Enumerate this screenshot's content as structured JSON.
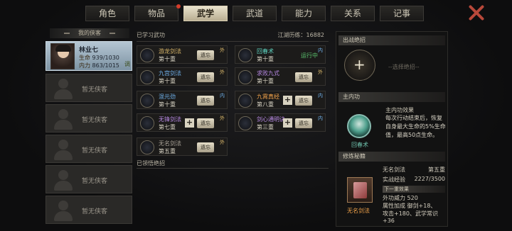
{
  "tabs": [
    {
      "label": "角色",
      "active": false
    },
    {
      "label": "物品",
      "active": false,
      "dot": true
    },
    {
      "label": "武学",
      "active": true
    },
    {
      "label": "武道",
      "active": false
    },
    {
      "label": "能力",
      "active": false
    },
    {
      "label": "关系",
      "active": false
    },
    {
      "label": "记事",
      "active": false
    }
  ],
  "left": {
    "header": "我的侠客",
    "hero": {
      "name": "林业七",
      "hp_label": "生命",
      "hp": "939/1030",
      "mp_label": "内力",
      "mp": "863/1015",
      "tag": "调"
    },
    "empty_slots": [
      "暂无侠客",
      "暂无侠客",
      "暂无侠客",
      "暂无侠客",
      "暂无侠客",
      "暂无侠客"
    ]
  },
  "middle": {
    "learned_title": "已学习武功",
    "exp_label": "江湖历练：16882",
    "forgotten_title": "已领悟绝招",
    "skills": [
      {
        "name": "游龙剑法",
        "level": "第十重",
        "action": "遗忘",
        "tag": "外",
        "color": "c-gold"
      },
      {
        "name": "回春术",
        "level": "第十重",
        "state": "运行中",
        "tag": "内",
        "color": "c-teal"
      },
      {
        "name": "九宫剑法",
        "level": "第十重",
        "action": "遗忘",
        "tag": "外",
        "color": "c-blue"
      },
      {
        "name": "求败九式",
        "level": "第十重",
        "action": "遗忘",
        "tag": "外",
        "color": "c-purple"
      },
      {
        "name": "混元劲",
        "level": "第十重",
        "action": "遗忘",
        "tag": "内",
        "color": "c-blue"
      },
      {
        "name": "九霄真经",
        "level": "第八重",
        "action": "遗忘",
        "tag": "内",
        "color": "c-orange",
        "plus": true
      },
      {
        "name": "无锋剑法",
        "level": "第七重",
        "action": "遗忘",
        "tag": "外",
        "color": "c-purple",
        "plus": true
      },
      {
        "name": "剑心通明诀",
        "level": "第三重",
        "action": "遗忘",
        "tag": "内",
        "color": "c-purple",
        "plus": true
      },
      {
        "name": "无名剑法",
        "level": "第五重",
        "action": "遗忘",
        "tag": "外",
        "color": "c-gray"
      }
    ]
  },
  "right": {
    "ultimate_header": "出战绝招",
    "ultimate_hint": "--选择绝招--",
    "inner_header": "主内功",
    "inner_name": "回春术",
    "inner_effect_title": "主内功效果",
    "inner_effect": "每次行动结束后，恢复自身最大生命的5%生命值，最高50点生命。",
    "train_header": "修炼秘籍",
    "book_name": "无名剑法",
    "train_name": "无名剑法",
    "train_level": "第五重",
    "exp_label": "实战经验",
    "exp_value": "2227/3500",
    "next_label": "下一重效果",
    "next_line1": "外功威力 520",
    "next_line2": "属性加成  御剑+18、",
    "next_line3": "攻击+180、武学常识",
    "next_line4": "+36"
  }
}
